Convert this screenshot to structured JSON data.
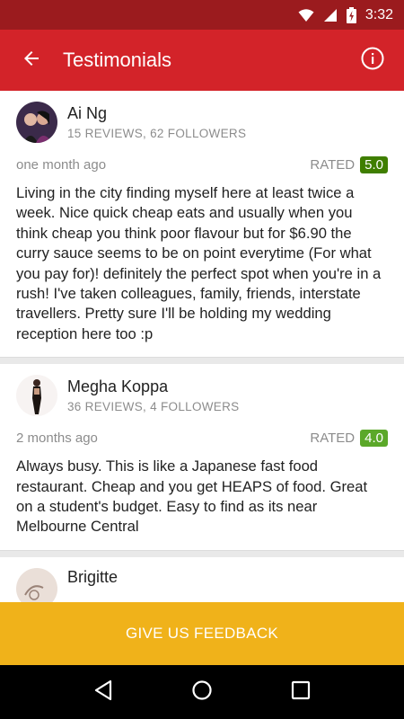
{
  "status_bar": {
    "time": "3:32"
  },
  "app_bar": {
    "title": "Testimonials"
  },
  "reviews": [
    {
      "name": "Ai Ng",
      "stats": "15 REVIEWS, 62 FOLLOWERS",
      "time": "one month ago",
      "rated_label": "RATED",
      "rating": "5.0",
      "rating_color": "#3f7e00",
      "text": "Living in the city finding myself here at least twice a week. Nice quick cheap eats and usually when you think cheap you think poor flavour but for $6.90 the curry sauce seems to be on point everytime (For what you pay for)! definitely the perfect spot when you're in a rush! I've taken colleagues, family, friends, interstate travellers. Pretty sure I'll be holding my wedding reception here too :p"
    },
    {
      "name": "Megha Koppa",
      "stats": "36 REVIEWS, 4 FOLLOWERS",
      "time": "2 months ago",
      "rated_label": "RATED",
      "rating": "4.0",
      "rating_color": "#5ba829",
      "text": "Always busy. This is like a Japanese fast food restaurant. Cheap and you get HEAPS of food. Great on a student's budget. Easy to find as its near Melbourne Central"
    },
    {
      "name": "Brigitte"
    }
  ],
  "feedback_button": {
    "label": "GIVE US FEEDBACK"
  },
  "colors": {
    "status_bar": "#9b1b1e",
    "app_bar": "#d32329",
    "feedback": "#f0b21a"
  },
  "icons": [
    "wifi-icon",
    "signal-icon",
    "battery-charging-icon",
    "back-arrow-icon",
    "info-icon",
    "nav-back-icon",
    "nav-home-icon",
    "nav-recents-icon"
  ]
}
